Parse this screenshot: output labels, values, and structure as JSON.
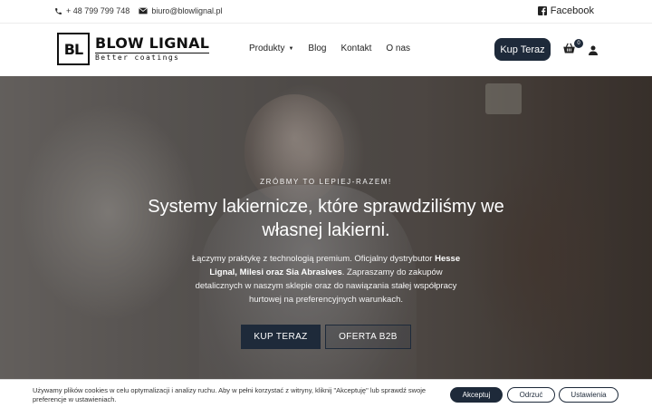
{
  "topbar": {
    "phone": "+ 48 799 799 748",
    "email": "biuro@blowlignal.pl",
    "social_label": "Facebook"
  },
  "header": {
    "logo_mark": "BL",
    "logo_brand": "BLOW LIGNAL",
    "logo_tagline": "Better coatings",
    "nav": [
      {
        "label": "Produkty",
        "has_dropdown": true
      },
      {
        "label": "Blog"
      },
      {
        "label": "Kontakt"
      },
      {
        "label": "O nas"
      }
    ],
    "buy_label": "Kup Teraz",
    "cart_count": "0"
  },
  "hero": {
    "kicker": "ZRÓBMY TO LEPIEJ-RAZEM!",
    "headline": "Systemy lakiernicze, które sprawdziliśmy we własnej lakierni.",
    "lead_part1": "Łączymy praktykę z technologią premium. Oficjalny dystrybutor ",
    "lead_bold": "Hesse Lignal, Milesi oraz Sia Abrasives",
    "lead_part2": ". Zapraszamy do zakupów detalicznych w naszym sklepie oraz do nawiązania stałej współpracy hurtowej na preferencyjnych warunkach.",
    "primary_button": "KUP TERAZ",
    "secondary_button": "OFERTA B2B"
  },
  "cookie": {
    "message": "Używamy plików cookies w celu optymalizacji i analizy ruchu. Aby w pełni korzystać z witryny, kliknij \"Akceptuję\" lub sprawdź swoje preferencje w ustawieniach.",
    "accept": "Akceptuj",
    "reject": "Odrzuć",
    "settings": "Ustawienia"
  },
  "colors": {
    "accent": "#1e2a3a"
  }
}
